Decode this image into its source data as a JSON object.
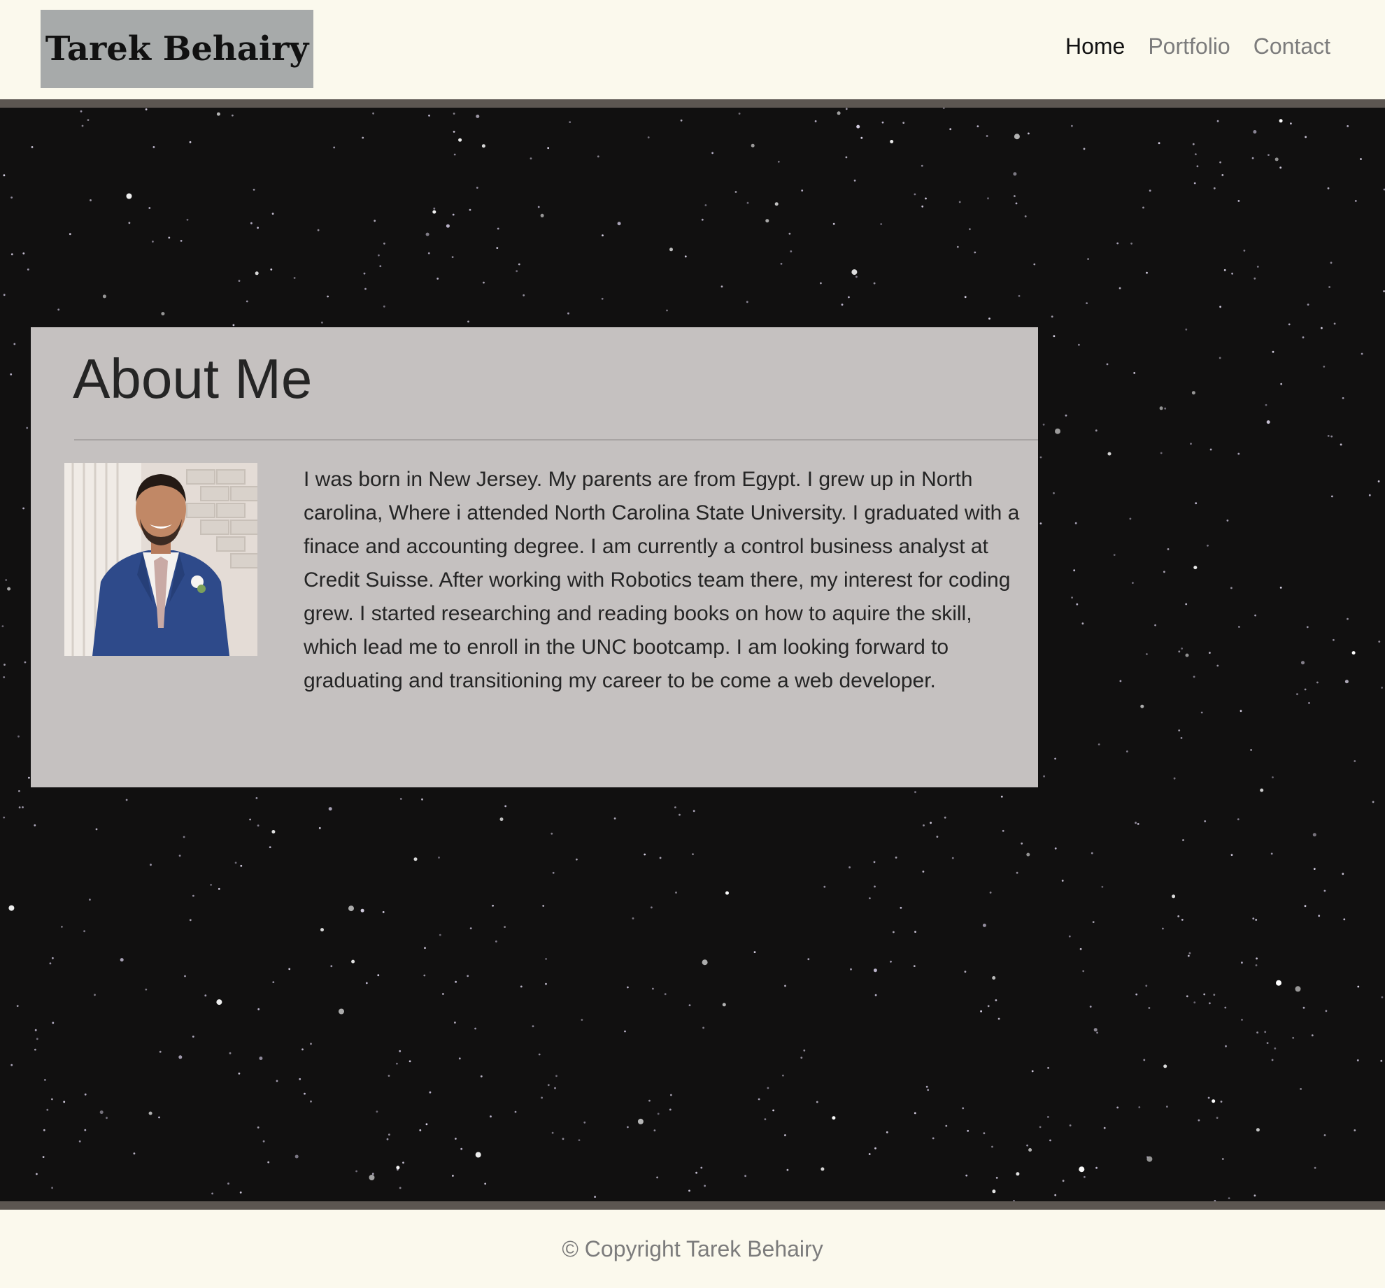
{
  "header": {
    "brand": "Tarek Behairy",
    "nav": [
      {
        "label": "Home",
        "active": true
      },
      {
        "label": "Portfolio",
        "active": false
      },
      {
        "label": "Contact",
        "active": false
      }
    ]
  },
  "about": {
    "title": "About Me",
    "bio": "I was born in New Jersey. My parents are from Egypt. I grew up in North carolina, Where i attended North Carolina State University. I graduated with a finace and accounting degree. I am currently a control business analyst at Credit Suisse. After working with Robotics team there, my interest for coding grew. I started researching and reading books on how to aquire the skill, which lead me to enroll in the UNC bootcamp. I am looking forward to graduating and transitioning my career to be come a web developer."
  },
  "footer": {
    "copyright": "© Copyright Tarek Behairy"
  },
  "colors": {
    "page_bg": "#fbf9ed",
    "brand_bg": "#a7aaaa",
    "border": "#5c5651",
    "card_bg": "#c5c1c0",
    "sky": "#111010"
  }
}
